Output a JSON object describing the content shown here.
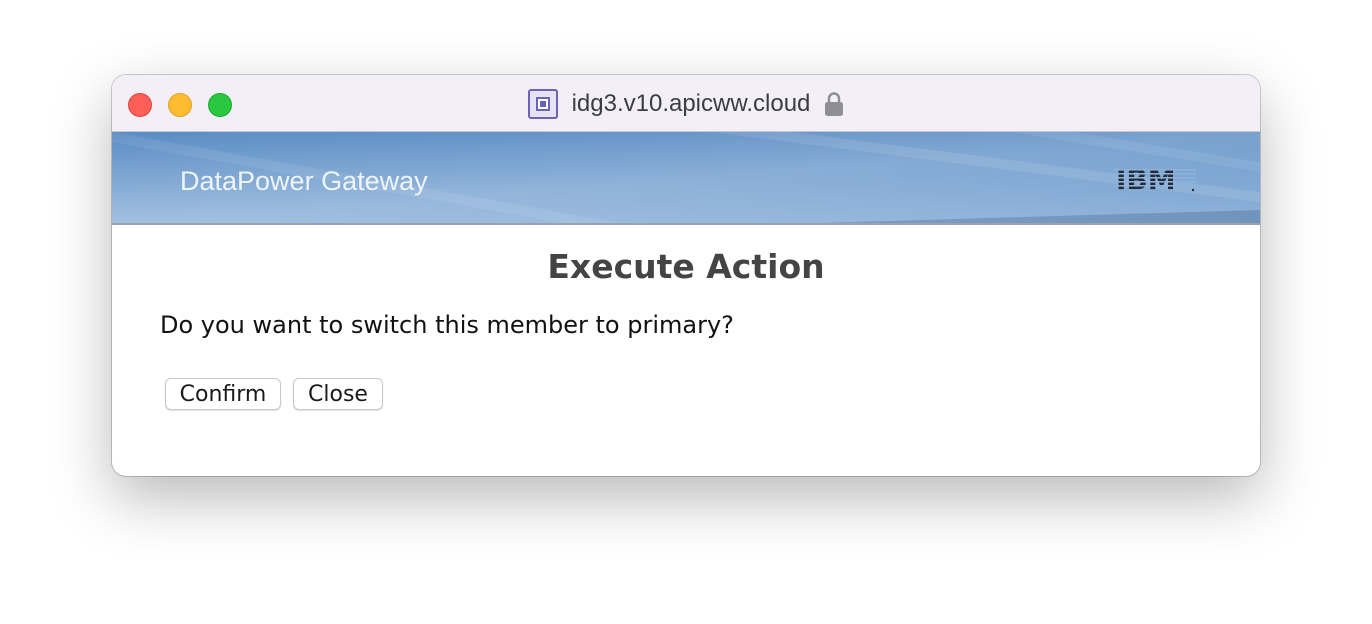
{
  "window": {
    "title": "idg3.v10.apicww.cloud",
    "traffic_lights": [
      "close",
      "minimize",
      "zoom"
    ]
  },
  "banner": {
    "product_name": "DataPower Gateway",
    "brand_logo": "IBM"
  },
  "dialog": {
    "title": "Execute Action",
    "message": "Do you want to switch this member to primary?",
    "confirm_label": "Confirm",
    "close_label": "Close"
  },
  "icons": {
    "site": "page-icon",
    "lock": "lock-icon"
  },
  "colors": {
    "traffic_close": "#fe5f57",
    "traffic_minimize": "#febc2e",
    "traffic_zoom": "#28c840",
    "banner_blue": "#6f9ccd",
    "title_text": "#444444"
  }
}
